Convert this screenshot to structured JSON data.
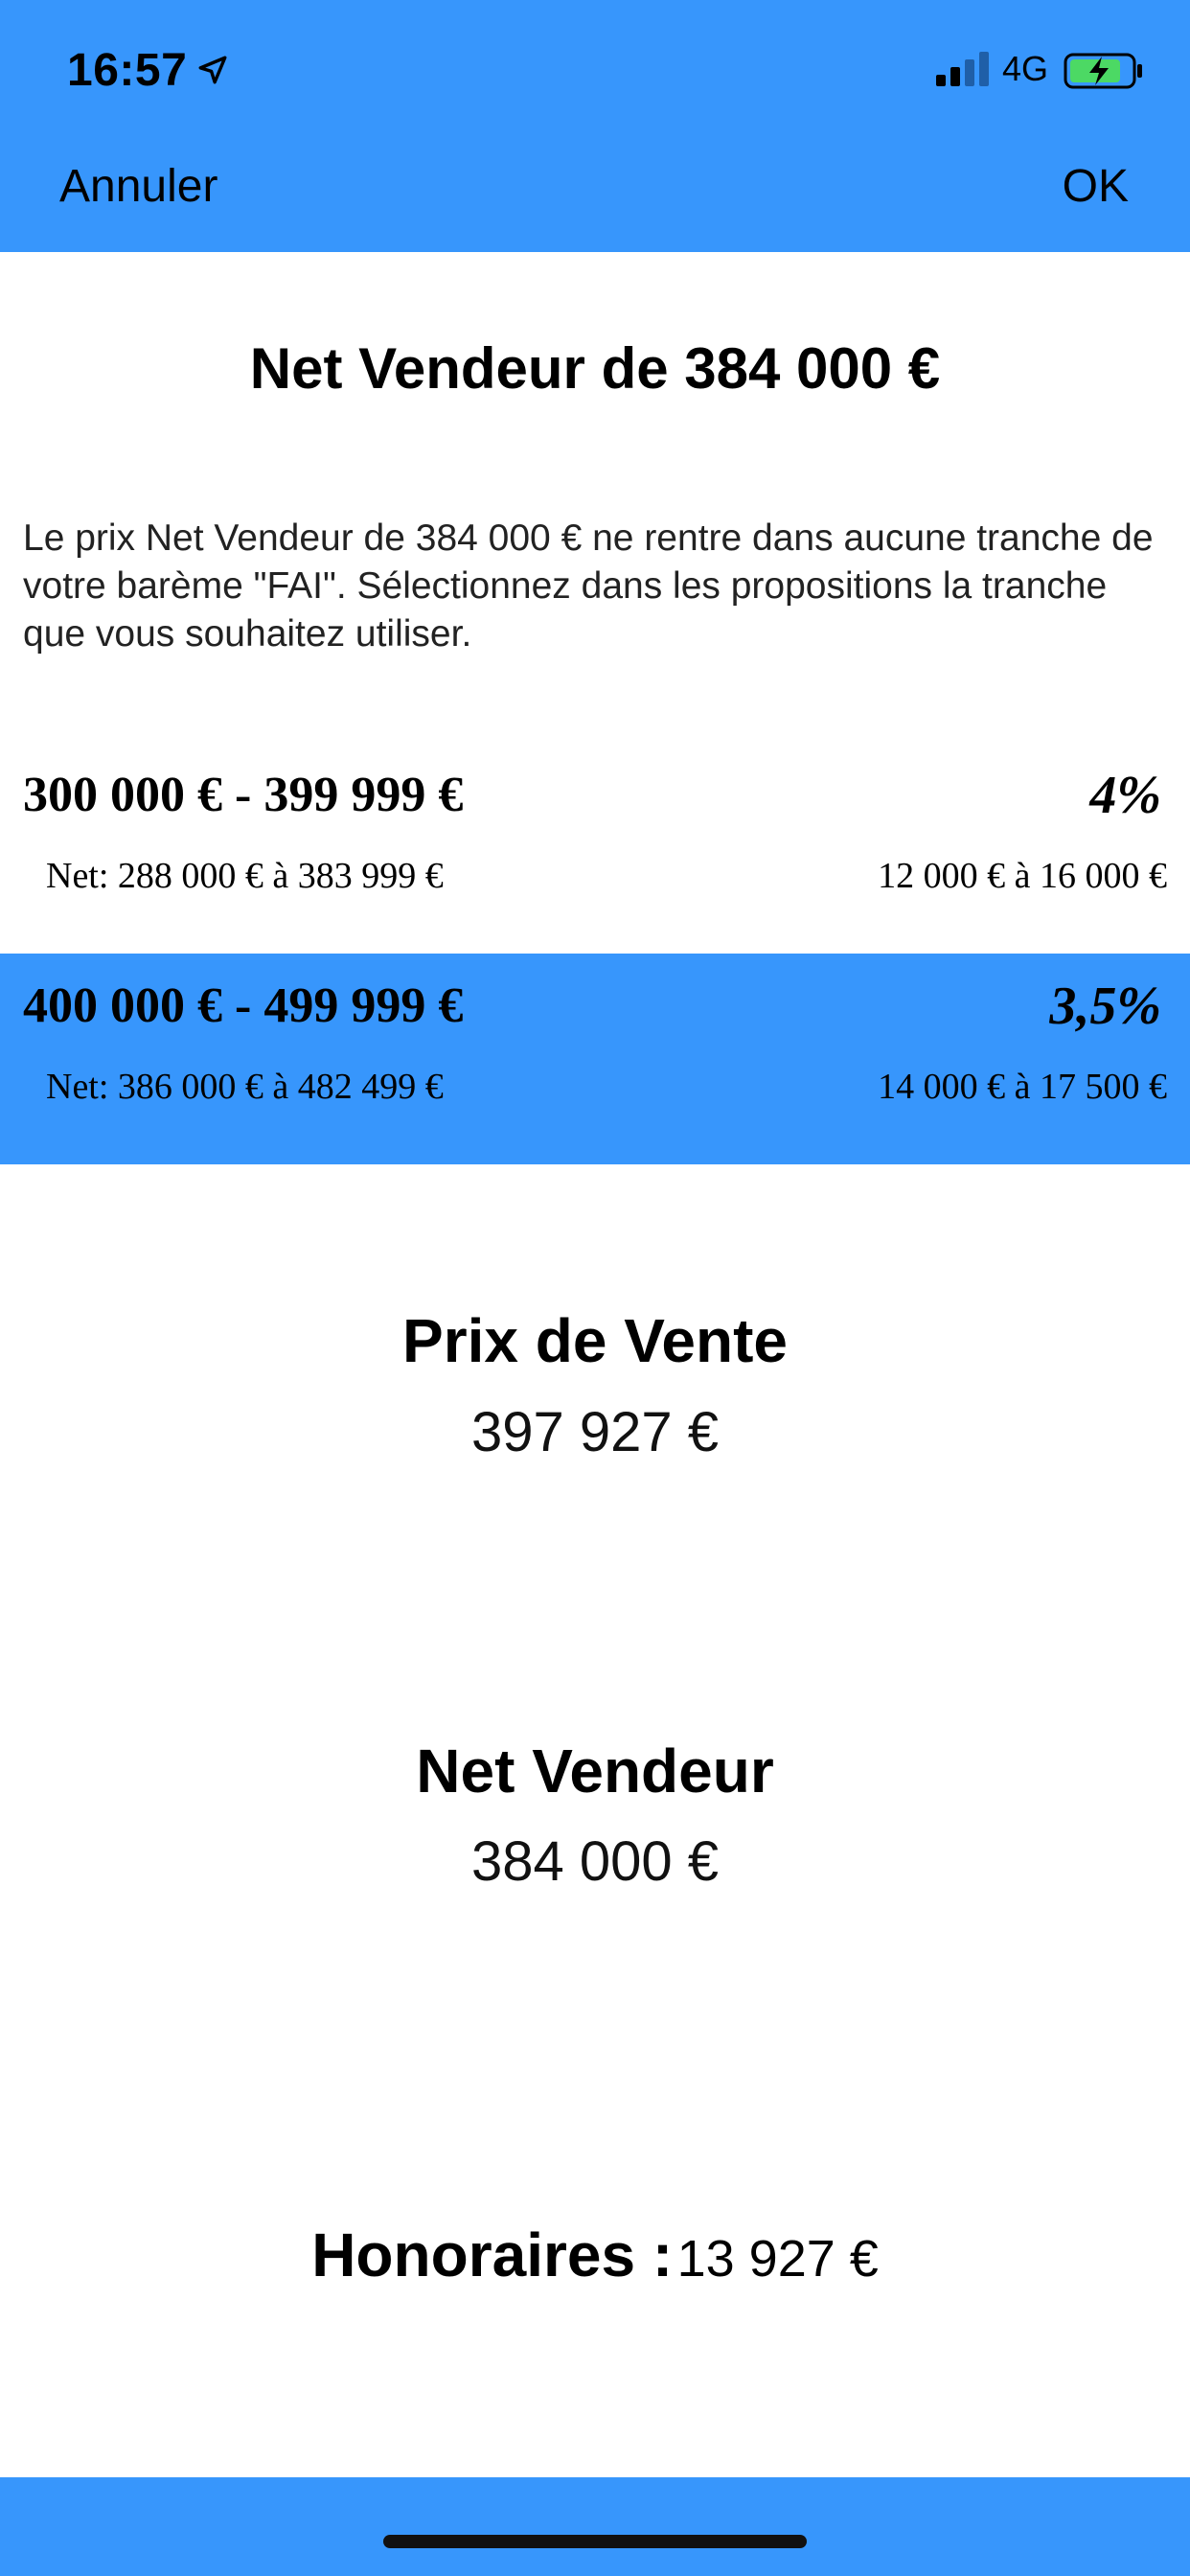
{
  "status_bar": {
    "time": "16:57",
    "network": "4G",
    "location_icon": "location-arrow-icon",
    "signal_icon": "signal-bars-icon",
    "battery_icon": "battery-charging-icon"
  },
  "nav": {
    "cancel_label": "Annuler",
    "ok_label": "OK"
  },
  "title": "Net Vendeur de 384 000 €",
  "description": "Le prix Net Vendeur de 384 000 € ne rentre dans aucune tranche de votre barème \"FAI\". Sélectionnez dans les propositions la tranche que vous souhaitez utiliser.",
  "tranches": [
    {
      "range": "300 000 € - 399 999 €",
      "rate": "4%",
      "net": "Net: 288 000 € à 383 999 €",
      "fees": "12 000 € à 16 000 €",
      "selected": false
    },
    {
      "range": "400 000 € - 499 999 €",
      "rate": "3,5%",
      "net": "Net: 386 000 € à 482 499 €",
      "fees": "14 000 € à 17 500 €",
      "selected": true
    }
  ],
  "sale_price": {
    "label": "Prix de Vente",
    "value": "397 927 €"
  },
  "net_seller": {
    "label": "Net Vendeur",
    "value": "384 000 €"
  },
  "fees": {
    "label": "Honoraires :",
    "value": "13 927 €"
  },
  "colors": {
    "accent": "#3796fc",
    "background": "#ffffff",
    "text": "#000000"
  }
}
